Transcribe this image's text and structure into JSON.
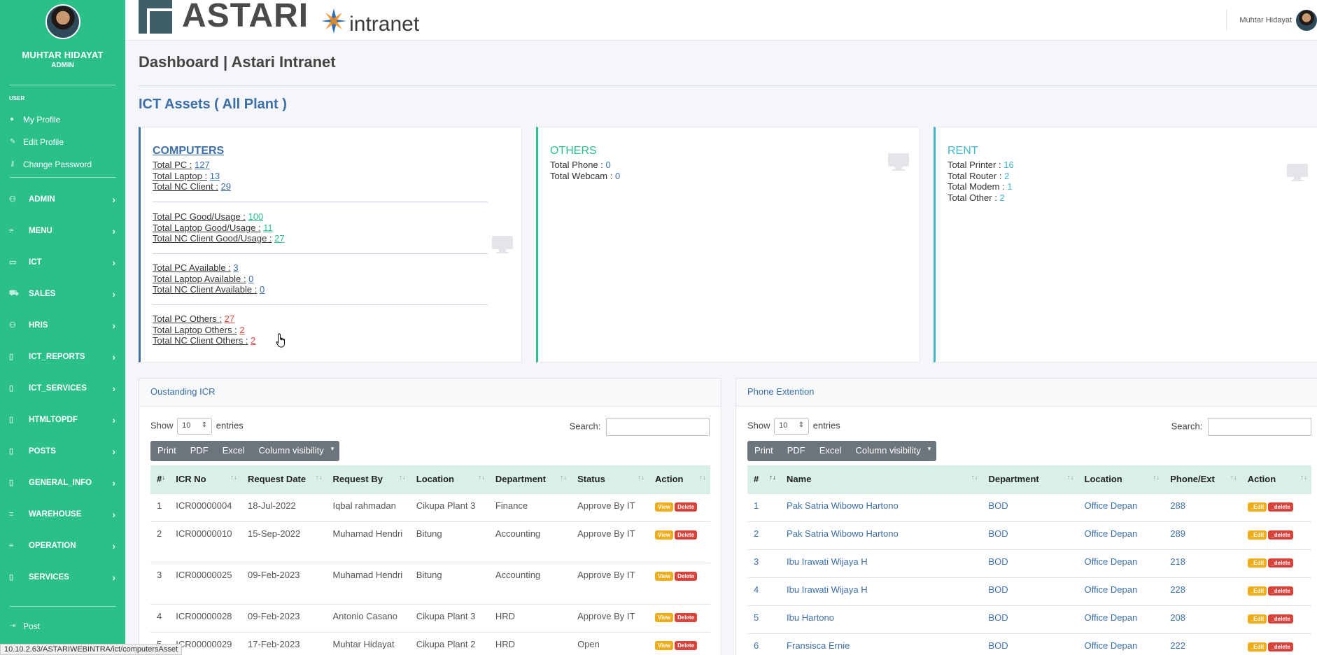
{
  "sidebar": {
    "user_name": "MUHTAR HIDAYAT",
    "user_role": "ADMIN",
    "section_user": "USER",
    "links": [
      {
        "label": "My Profile",
        "icon": "user-icon"
      },
      {
        "label": "Edit Profile",
        "icon": "user-edit-icon"
      },
      {
        "label": "Change Password",
        "icon": "key-icon"
      }
    ],
    "menus": [
      {
        "label": "ADMIN",
        "icon": "users-icon"
      },
      {
        "label": "MENU",
        "icon": "list-icon"
      },
      {
        "label": "ICT",
        "icon": "laptop-icon"
      },
      {
        "label": "SALES",
        "icon": "cart-icon"
      },
      {
        "label": "HRIS",
        "icon": "users-icon"
      },
      {
        "label": "ICT_REPORTS",
        "icon": "file-icon"
      },
      {
        "label": "ICT_SERVICES",
        "icon": "file-icon"
      },
      {
        "label": "HTMLTOPDF",
        "icon": "file-icon"
      },
      {
        "label": "POSTS",
        "icon": "file-icon"
      },
      {
        "label": "GENERAL_INFO",
        "icon": "file-icon"
      },
      {
        "label": "WAREHOUSE",
        "icon": "list-icon"
      },
      {
        "label": "OPERATION",
        "icon": "list-icon"
      },
      {
        "label": "SERVICES",
        "icon": "file-icon"
      }
    ],
    "bottom_link": {
      "label": "Post",
      "icon": "sign-out-icon"
    }
  },
  "header": {
    "logo_text": "ASTARI",
    "logo_sub": "intranet",
    "user_name": "Muhtar Hidayat"
  },
  "page": {
    "title": "Dashboard | Astari Intranet",
    "section_title": "ICT Assets ( All Plant )"
  },
  "cards": {
    "computers": {
      "title": "COMPUTERS",
      "groups": [
        [
          {
            "label": "Total PC :",
            "value": "127",
            "color": "blue"
          },
          {
            "label": "Total Laptop :",
            "value": "13",
            "color": "blue"
          },
          {
            "label": "Total NC Client :",
            "value": "29",
            "color": "blue"
          }
        ],
        [
          {
            "label": "Total PC Good/Usage :",
            "value": "100",
            "color": "green"
          },
          {
            "label": "Total Laptop Good/Usage :",
            "value": "11",
            "color": "green"
          },
          {
            "label": "Total NC Client Good/Usage :",
            "value": "27",
            "color": "green"
          }
        ],
        [
          {
            "label": "Total PC Available :",
            "value": "3",
            "color": "blue"
          },
          {
            "label": "Total Laptop Available :",
            "value": "0",
            "color": "blue"
          },
          {
            "label": "Total NC Client Available :",
            "value": "0",
            "color": "blue"
          }
        ],
        [
          {
            "label": "Total PC Others :",
            "value": "27",
            "color": "red"
          },
          {
            "label": "Total Laptop Others :",
            "value": "2",
            "color": "red"
          },
          {
            "label": "Total NC Client Others :",
            "value": "2",
            "color": "red"
          }
        ]
      ]
    },
    "others": {
      "title": "OTHERS",
      "lines": [
        {
          "label": "Total Phone :",
          "value": "0"
        },
        {
          "label": "Total Webcam :",
          "value": "0"
        }
      ]
    },
    "rent": {
      "title": "RENT",
      "lines": [
        {
          "label": "Total Printer :",
          "value": "16"
        },
        {
          "label": "Total Router :",
          "value": "2"
        },
        {
          "label": "Total Modem :",
          "value": "1"
        },
        {
          "label": "Total Other :",
          "value": "2"
        }
      ]
    }
  },
  "icr_table": {
    "title": "Oustanding ICR",
    "show_label": "Show",
    "show_value": "10",
    "entries_label": "entries",
    "search_label": "Search:",
    "buttons": [
      "Print",
      "PDF",
      "Excel",
      "Column visibility"
    ],
    "columns": [
      "#",
      "ICR No",
      "Request Date",
      "Request By",
      "Location",
      "Department",
      "Status",
      "Action"
    ],
    "rows": [
      [
        "1",
        "ICR00000004",
        "18-Jul-2022",
        "Iqbal rahmadan",
        "Cikupa Plant 3",
        "Finance",
        "Approve By IT"
      ],
      [
        "2",
        "ICR00000010",
        "15-Sep-2022",
        "Muhamad Hendri",
        "Bitung",
        "Accounting",
        "Approve By IT"
      ],
      [
        "3",
        "ICR00000025",
        "09-Feb-2023",
        "Muhamad Hendri",
        "Bitung",
        "Accounting",
        "Approve By IT"
      ],
      [
        "4",
        "ICR00000028",
        "09-Feb-2023",
        "Antonio Casano",
        "Cikupa Plant 3",
        "HRD",
        "Approve By IT"
      ],
      [
        "5",
        "ICR00000029",
        "17-Feb-2023",
        "Muhtar Hidayat",
        "Cikupa Plant 2",
        "HRD",
        "Open"
      ]
    ],
    "action_view": "View",
    "action_delete": "Delete"
  },
  "phone_table": {
    "title": "Phone Extention",
    "show_label": "Show",
    "show_value": "10",
    "entries_label": "entries",
    "search_label": "Search:",
    "buttons": [
      "Print",
      "PDF",
      "Excel",
      "Column visibility"
    ],
    "columns": [
      "#",
      "Name",
      "Department",
      "Location",
      "Phone/Ext",
      "Action"
    ],
    "rows": [
      [
        "1",
        "Pak Satria Wibowo Hartono",
        "BOD",
        "Office Depan",
        "288"
      ],
      [
        "2",
        "Pak Satria Wibowo Hartono",
        "BOD",
        "Office Depan",
        "289"
      ],
      [
        "3",
        "Ibu Irawati Wijaya H",
        "BOD",
        "Office Depan",
        "218"
      ],
      [
        "4",
        "Ibu Irawati Wijaya H",
        "BOD",
        "Office Depan",
        "228"
      ],
      [
        "5",
        "Ibu Hartono",
        "BOD",
        "Office Depan",
        "208"
      ],
      [
        "6",
        "Fransisca Ernie",
        "BOD",
        "Office Depan",
        "222"
      ]
    ],
    "action_edit": "_Edit",
    "action_delete": "_delete"
  },
  "status_bar": "10.10.2.63/ASTARIWEBINTRA/ict/computersAsset",
  "colors": {
    "sidebar": "#2bbf8a",
    "primary": "#3d6fa8",
    "cyan": "#3fb6c9",
    "danger": "#d9423a",
    "warning": "#f0ad1b"
  }
}
